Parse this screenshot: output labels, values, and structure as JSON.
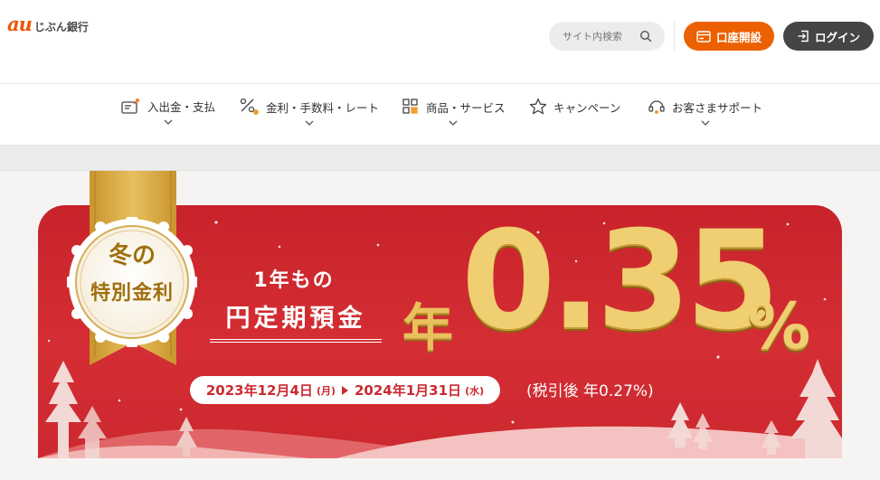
{
  "header": {
    "logo_mark": "au",
    "logo_text": "じぶん銀行",
    "search_placeholder": "サイト内検索",
    "open_account_label": "口座開設",
    "login_label": "ログイン"
  },
  "nav": {
    "items": [
      {
        "label": "入出金・支払",
        "icon": "wallet-icon"
      },
      {
        "label": "金利・手数料・レート",
        "icon": "percent-icon"
      },
      {
        "label": "商品・サービス",
        "icon": "grid-icon"
      },
      {
        "label": "キャンペーン",
        "icon": "star-icon"
      },
      {
        "label": "お客さまサポート",
        "icon": "support-icon"
      }
    ]
  },
  "banner": {
    "badge_line1": "冬の",
    "badge_line2": "特別金利",
    "title_line1": "1年もの",
    "title_line2": "円定期預金",
    "rate_prefix": "年",
    "rate_value": "0.35",
    "rate_unit": "%",
    "period_start": "2023年12月4日",
    "period_start_day": "(月)",
    "period_end": "2024年1月31日",
    "period_end_day": "(水)",
    "after_tax": "(税引後 年0.27%)"
  },
  "colors": {
    "brand_orange": "#eb6100",
    "login_dark": "#454545",
    "banner_red": "#cc282f",
    "gold": "#f0cf72"
  }
}
